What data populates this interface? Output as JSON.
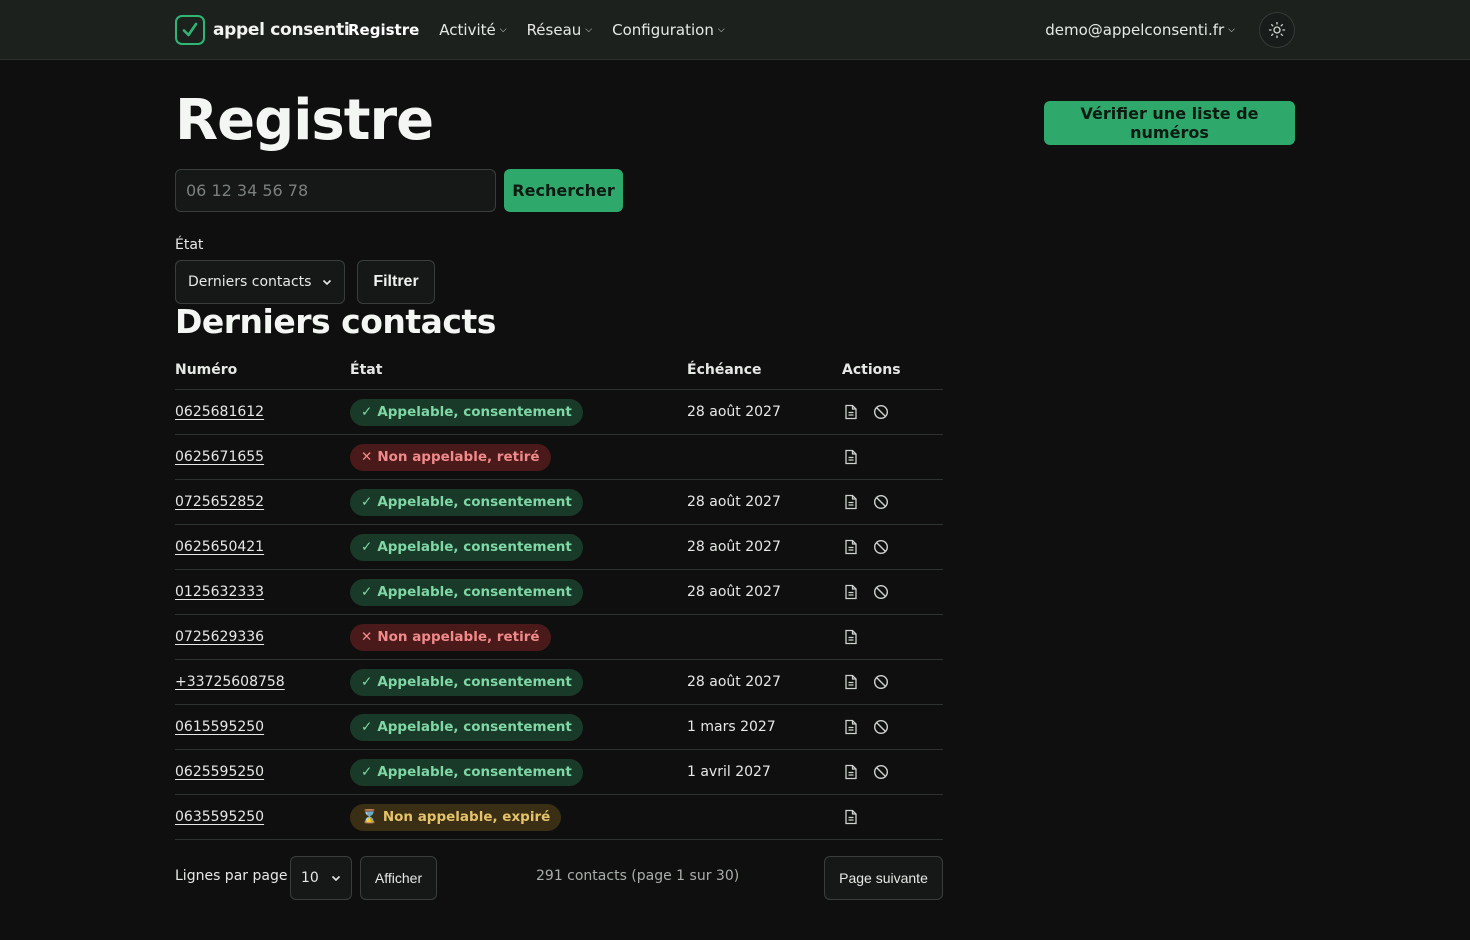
{
  "nav": {
    "brand": "appel consenti",
    "links": [
      {
        "label": "Registre",
        "active": true,
        "dropdown": false
      },
      {
        "label": "Activité",
        "active": false,
        "dropdown": true
      },
      {
        "label": "Réseau",
        "active": false,
        "dropdown": true
      },
      {
        "label": "Configuration",
        "active": false,
        "dropdown": true
      }
    ],
    "user": "demo@appelconsenti.fr",
    "theme_icon": "sun-icon"
  },
  "header": {
    "title": "Registre",
    "verify_button": "Vérifier une liste de numéros"
  },
  "search": {
    "placeholder": "06 12 34 56 78",
    "button": "Rechercher"
  },
  "filter": {
    "label": "État",
    "selected": "Derniers contacts",
    "button": "Filtrer"
  },
  "section_title": "Derniers contacts",
  "table": {
    "columns": [
      "Numéro",
      "État",
      "Échéance",
      "Actions"
    ],
    "rows": [
      {
        "numero": "0625681612",
        "etat": "Appelable, consentement",
        "status": "ok",
        "echeance": "28 août 2027"
      },
      {
        "numero": "0625671655",
        "etat": "Non appelable, retiré",
        "status": "no",
        "echeance": ""
      },
      {
        "numero": "0725652852",
        "etat": "Appelable, consentement",
        "status": "ok",
        "echeance": "28 août 2027"
      },
      {
        "numero": "0625650421",
        "etat": "Appelable, consentement",
        "status": "ok",
        "echeance": "28 août 2027"
      },
      {
        "numero": "0125632333",
        "etat": "Appelable, consentement",
        "status": "ok",
        "echeance": "28 août 2027"
      },
      {
        "numero": "0725629336",
        "etat": "Non appelable, retiré",
        "status": "no",
        "echeance": ""
      },
      {
        "numero": "+33725608758",
        "etat": "Appelable, consentement",
        "status": "ok",
        "echeance": "28 août 2027"
      },
      {
        "numero": "0615595250",
        "etat": "Appelable, consentement",
        "status": "ok",
        "echeance": "1 mars 2027"
      },
      {
        "numero": "0625595250",
        "etat": "Appelable, consentement",
        "status": "ok",
        "echeance": "1 avril 2027"
      },
      {
        "numero": "0635595250",
        "etat": "Non appelable, expiré",
        "status": "exp",
        "echeance": ""
      }
    ]
  },
  "pagination": {
    "rows_label": "Lignes par page",
    "rows_value": "10",
    "show_button": "Afficher",
    "info": "291 contacts (page 1 sur 30)",
    "next_button": "Page suivante"
  },
  "colors": {
    "accent": "#2fa86b",
    "ok_bg": "#1a3a29",
    "no_bg": "#4a1a1a",
    "exp_bg": "#3a2f14"
  }
}
